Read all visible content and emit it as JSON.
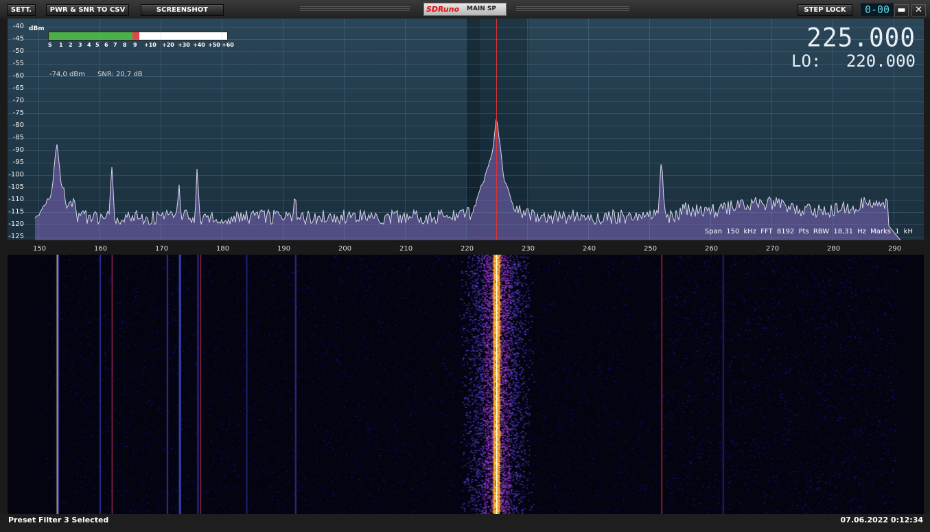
{
  "toolbar": {
    "settings_label": "SETT.",
    "csv_label": "PWR & SNR TO CSV",
    "screenshot_label": "SCREENSHOT",
    "step_lock_label": "STEP LOCK",
    "lcd_value": "0-00",
    "minimize_glyph": "▬",
    "close_glyph": "✕"
  },
  "logo": {
    "brand": "SDRuno",
    "window_name": "MAIN SP"
  },
  "spectrum": {
    "dbm_unit": "dBm",
    "y_labels": [
      "-40",
      "-45",
      "-50",
      "-55",
      "-60",
      "-65",
      "-70",
      "-75",
      "-80",
      "-85",
      "-90",
      "-95",
      "-100",
      "-105",
      "-110",
      "-115",
      "-120",
      "-125"
    ],
    "smeter_labels": [
      "S",
      "1",
      "2",
      "3",
      "4",
      "5",
      "6",
      "7",
      "8",
      "9",
      "+10",
      "+20",
      "+30",
      "+40",
      "+50",
      "+60"
    ],
    "smeter_level_db": 59,
    "power_readout": "-74,0 dBm",
    "snr_readout": "SNR: 20,7 dB",
    "frequency": "225.000",
    "lo_label": "LO:",
    "lo_frequency": "220.000",
    "info_text": "Span 150 kHz  FFT 8192 Pts  RBW 18,31 Hz  Marks 1 kH",
    "x_labels": [
      "150",
      "160",
      "170",
      "180",
      "190",
      "200",
      "210",
      "220",
      "230",
      "240",
      "250",
      "260",
      "270",
      "280",
      "290"
    ]
  },
  "status": {
    "message": "Preset Filter 3 Selected",
    "datetime": "07.06.2022 0:12:34"
  },
  "colors": {
    "trace": "#d8d8e8",
    "fill": "#6a5aa0",
    "tune_marker": "#e03030",
    "waterfall_signal": "#ffd040"
  }
}
